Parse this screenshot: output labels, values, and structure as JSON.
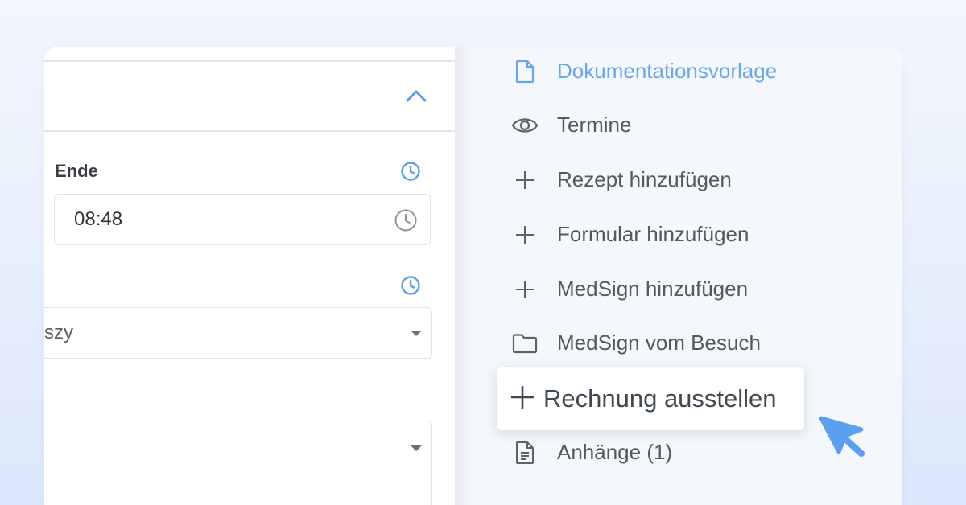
{
  "form": {
    "end_label": "Ende",
    "end_time_value": "08:48",
    "select1_value": "szy",
    "select2_value": ""
  },
  "menu": {
    "items": [
      {
        "label": "Dokumentationsvorlage",
        "icon": "document-icon",
        "active": true
      },
      {
        "label": "Termine",
        "icon": "eye-icon"
      },
      {
        "label": "Rezept hinzufügen",
        "icon": "plus-icon"
      },
      {
        "label": "Formular hinzufügen",
        "icon": "plus-icon"
      },
      {
        "label": "MedSign hinzufügen",
        "icon": "plus-icon"
      },
      {
        "label": "MedSign vom Besuch",
        "icon": "folder-icon"
      },
      {
        "label": "Rechnung ausstellen",
        "icon": "plus-icon",
        "highlighted": true
      },
      {
        "label": "Anhänge (1)",
        "icon": "file-text-icon"
      }
    ]
  },
  "colors": {
    "accent": "#6aa5ee",
    "text": "#54595f",
    "cursor": "#5b9ff0"
  }
}
